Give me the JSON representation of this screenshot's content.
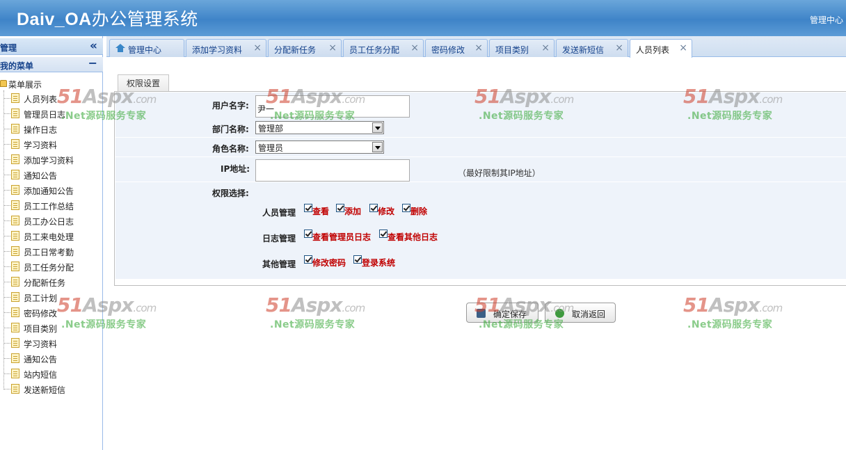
{
  "header": {
    "title_en": "Daiv_OA",
    "title_cn": "办公管理系统",
    "right_link": "管理中心"
  },
  "sidebar": {
    "panel_title": "管理",
    "collapse_glyph": "«",
    "menu_title": "我的菜单",
    "menu_toggle": "−",
    "root": "菜单展示",
    "items": [
      "人员列表",
      "管理员日志",
      "操作日志",
      "学习资料",
      "添加学习资料",
      "通知公告",
      "添加通知公告",
      "员工工作总结",
      "员工办公日志",
      "员工来电处理",
      "员工日常考勤",
      "员工任务分配",
      "分配新任务",
      "员工计划",
      "密码修改",
      "项目类别",
      "学习资料",
      "通知公告",
      "站内短信",
      "发送新短信"
    ]
  },
  "tabs": [
    {
      "label": "管理中心",
      "closable": false,
      "active": false,
      "icon": "home-icon"
    },
    {
      "label": "添加学习资料",
      "closable": true,
      "active": false
    },
    {
      "label": "分配新任务",
      "closable": true,
      "active": false
    },
    {
      "label": "员工任务分配",
      "closable": true,
      "active": false
    },
    {
      "label": "密码修改",
      "closable": true,
      "active": false
    },
    {
      "label": "项目类别",
      "closable": true,
      "active": false
    },
    {
      "label": "发送新短信",
      "closable": true,
      "active": false
    },
    {
      "label": "人员列表",
      "closable": true,
      "active": true
    }
  ],
  "close_glyph": "×",
  "form": {
    "section_tab": "权限设置",
    "username_label": "用户名字:",
    "username_value": "尹一",
    "dept_label": "部门名称:",
    "dept_value": "管理部",
    "role_label": "角色名称:",
    "role_value": "管理员",
    "ip_label": "IP地址:",
    "ip_value": "",
    "ip_hint": "（最好限制其IP地址）",
    "perm_label": "权限选择:",
    "groups": [
      {
        "name": "人员管理",
        "perms": [
          "查看",
          "添加",
          "修改",
          "删除"
        ]
      },
      {
        "name": "日志管理",
        "perms": [
          "查看管理员日志",
          "查看其他日志"
        ]
      },
      {
        "name": "其他管理",
        "perms": [
          "修改密码",
          "登录系统"
        ]
      }
    ],
    "save_button": "确定保存",
    "cancel_button": "取消返回"
  },
  "watermark": {
    "brand_num": "51",
    "brand_asp": "Aspx",
    "brand_com": ".com",
    "slogan": ".Net源码服务专家"
  },
  "colors": {
    "header": "#3f84c8",
    "perm_text": "#c00000",
    "watermark_red": "#cd3c28",
    "watermark_green": "#3caa3c"
  }
}
